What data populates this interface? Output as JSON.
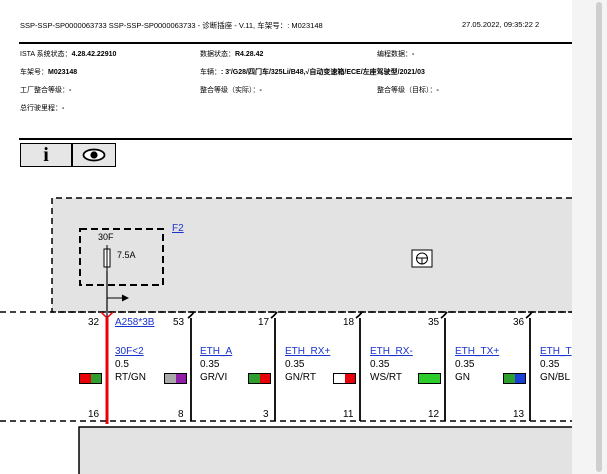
{
  "header": {
    "title": "SSP-SSP-SP0000063733 SSP-SSP-SP0000063733 - 诊断插座 - V.11, 车架号：: M023148",
    "datetime": "27.05.2022, 09:35:22 2"
  },
  "meta": {
    "ista_label": "ISTA 系统状态：",
    "ista_value": "4.28.42.22910",
    "data_label": "数据状态：",
    "data_value": "R4.28.42",
    "prog_label": "编程数据：",
    "prog_value": "-",
    "vin_label": "车架号：",
    "vin_value": "M023148",
    "vehicle_label": "车辆：",
    "vehicle_value": ": 3'/G28/四门车/325Li/B48,√自动变速箱/ECE/左座驾驶型/2021/03",
    "factory_label": "工厂整合等级：",
    "factory_value": "-",
    "actual_label": "整合等级（实际）：",
    "actual_value": "-",
    "target_label": "整合等级（目标）：",
    "target_value": "-",
    "mileage_label": "总行驶里程：",
    "mileage_value": "-"
  },
  "toolbar": {
    "info_icon": "i",
    "view_icon": "eye-icon"
  },
  "diagram": {
    "fuse_link": "F2",
    "fuse_rating": "30F",
    "fuse_value": "7.5A",
    "connector_link": "A258*3B",
    "pins": [
      {
        "top": "32",
        "bottom": "16"
      },
      {
        "top": "53",
        "bottom": "8"
      },
      {
        "top": "17",
        "bottom": "3"
      },
      {
        "top": "18",
        "bottom": "11"
      },
      {
        "top": "35",
        "bottom": "12"
      },
      {
        "top": "36",
        "bottom": "13"
      }
    ],
    "wires": [
      {
        "name": "30F<2",
        "size": "0.5",
        "color": "RT/GN",
        "c1": "#e8000b",
        "c2": "#2e9e2e"
      },
      {
        "name": "",
        "size": "0.35",
        "color": "GR/VI",
        "c1": "#a9a9a9",
        "c2": "#8e1fa6"
      },
      {
        "name": "ETH_A",
        "size": "0.35",
        "color": "GR/VI",
        "c1": "#2e9e2e",
        "c2": "#e8000b"
      },
      {
        "name": "ETH_RX+",
        "size": "0.35",
        "color": "GN/RT",
        "c1": "#ffffff",
        "c2": "#e8000b"
      },
      {
        "name": "ETH_RX-",
        "size": "0.35",
        "color": "WS/RT",
        "c1": "#2bcc2b",
        "c2": "#2bcc2b"
      },
      {
        "name": "ETH_TX+",
        "size": "0.35",
        "color": "GN",
        "c1": "#2e9e2e",
        "c2": "#1a3fd6"
      },
      {
        "name": "ETH_T",
        "size": "0.35",
        "color": "GN/BL"
      }
    ]
  }
}
